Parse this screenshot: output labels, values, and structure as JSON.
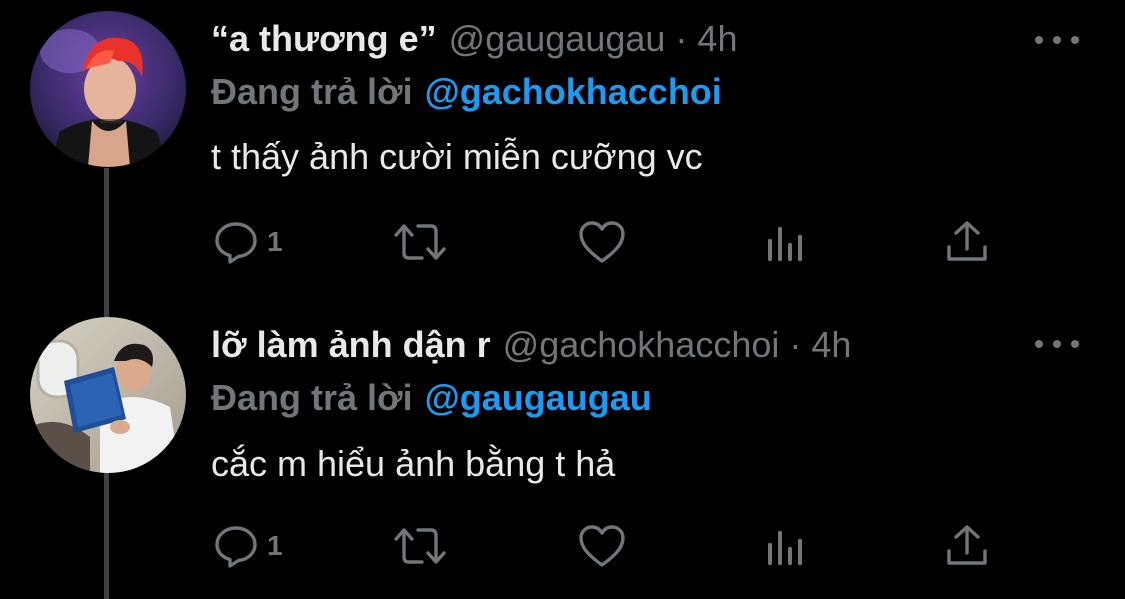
{
  "tweets": [
    {
      "display_name": "“a thương e”",
      "handle": "@gaugaugau",
      "separator": "·",
      "time": "4h",
      "reply_prefix": "Đang trả lời",
      "reply_mention": "@gachokhacchoi",
      "text": "t thấy ảnh cười miễn cưỡng vc",
      "reply_count": "1",
      "avatar_icon": "red-haired-performer-avatar"
    },
    {
      "display_name": "lỡ làm ảnh dận r",
      "handle": "@gachokhacchoi",
      "separator": "·",
      "time": "4h",
      "reply_prefix": "Đang trả lời",
      "reply_mention": "@gaugaugau",
      "text": "cắc m hiểu ảnh bằng t hả",
      "reply_count": "1",
      "avatar_icon": "man-reading-on-plane-avatar"
    }
  ],
  "icons": {
    "reply": "speech-bubble-icon",
    "retweet": "retweet-arrows-icon",
    "like": "heart-icon",
    "views": "bar-chart-icon",
    "share": "share-upload-icon",
    "more": "more-dots-icon"
  },
  "colors": {
    "background": "#000000",
    "primary_text": "#e7e9ea",
    "secondary_text": "#71767b",
    "accent": "#1d9bf0",
    "thread_line": "#3e4144"
  }
}
